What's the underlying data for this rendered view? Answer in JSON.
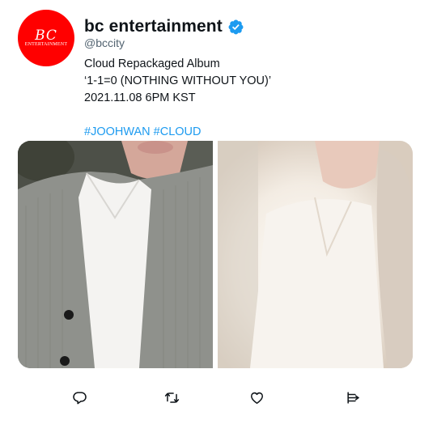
{
  "tweet": {
    "avatar": {
      "logo_text": "BC",
      "logo_subtext": "ENTERTAINMENT"
    },
    "author": {
      "display_name": "bc entertainment",
      "handle": "@bccity",
      "verified": true
    },
    "lines": [
      "Cloud Repackaged Album",
      "‘1-1=0 (NOTHING WITHOUT YOU)’",
      "2021.11.08 6PM KST"
    ],
    "hashtags": [
      "#JOOHWAN",
      "#CLOUD"
    ],
    "media": [
      {
        "description": "photo-1"
      },
      {
        "description": "photo-2"
      }
    ],
    "actions": [
      "reply",
      "retweet",
      "like",
      "share"
    ]
  },
  "colors": {
    "accent": "#1d9bf0",
    "avatar_bg": "#ff0000",
    "text_primary": "#0f1419",
    "text_secondary": "#536471"
  }
}
